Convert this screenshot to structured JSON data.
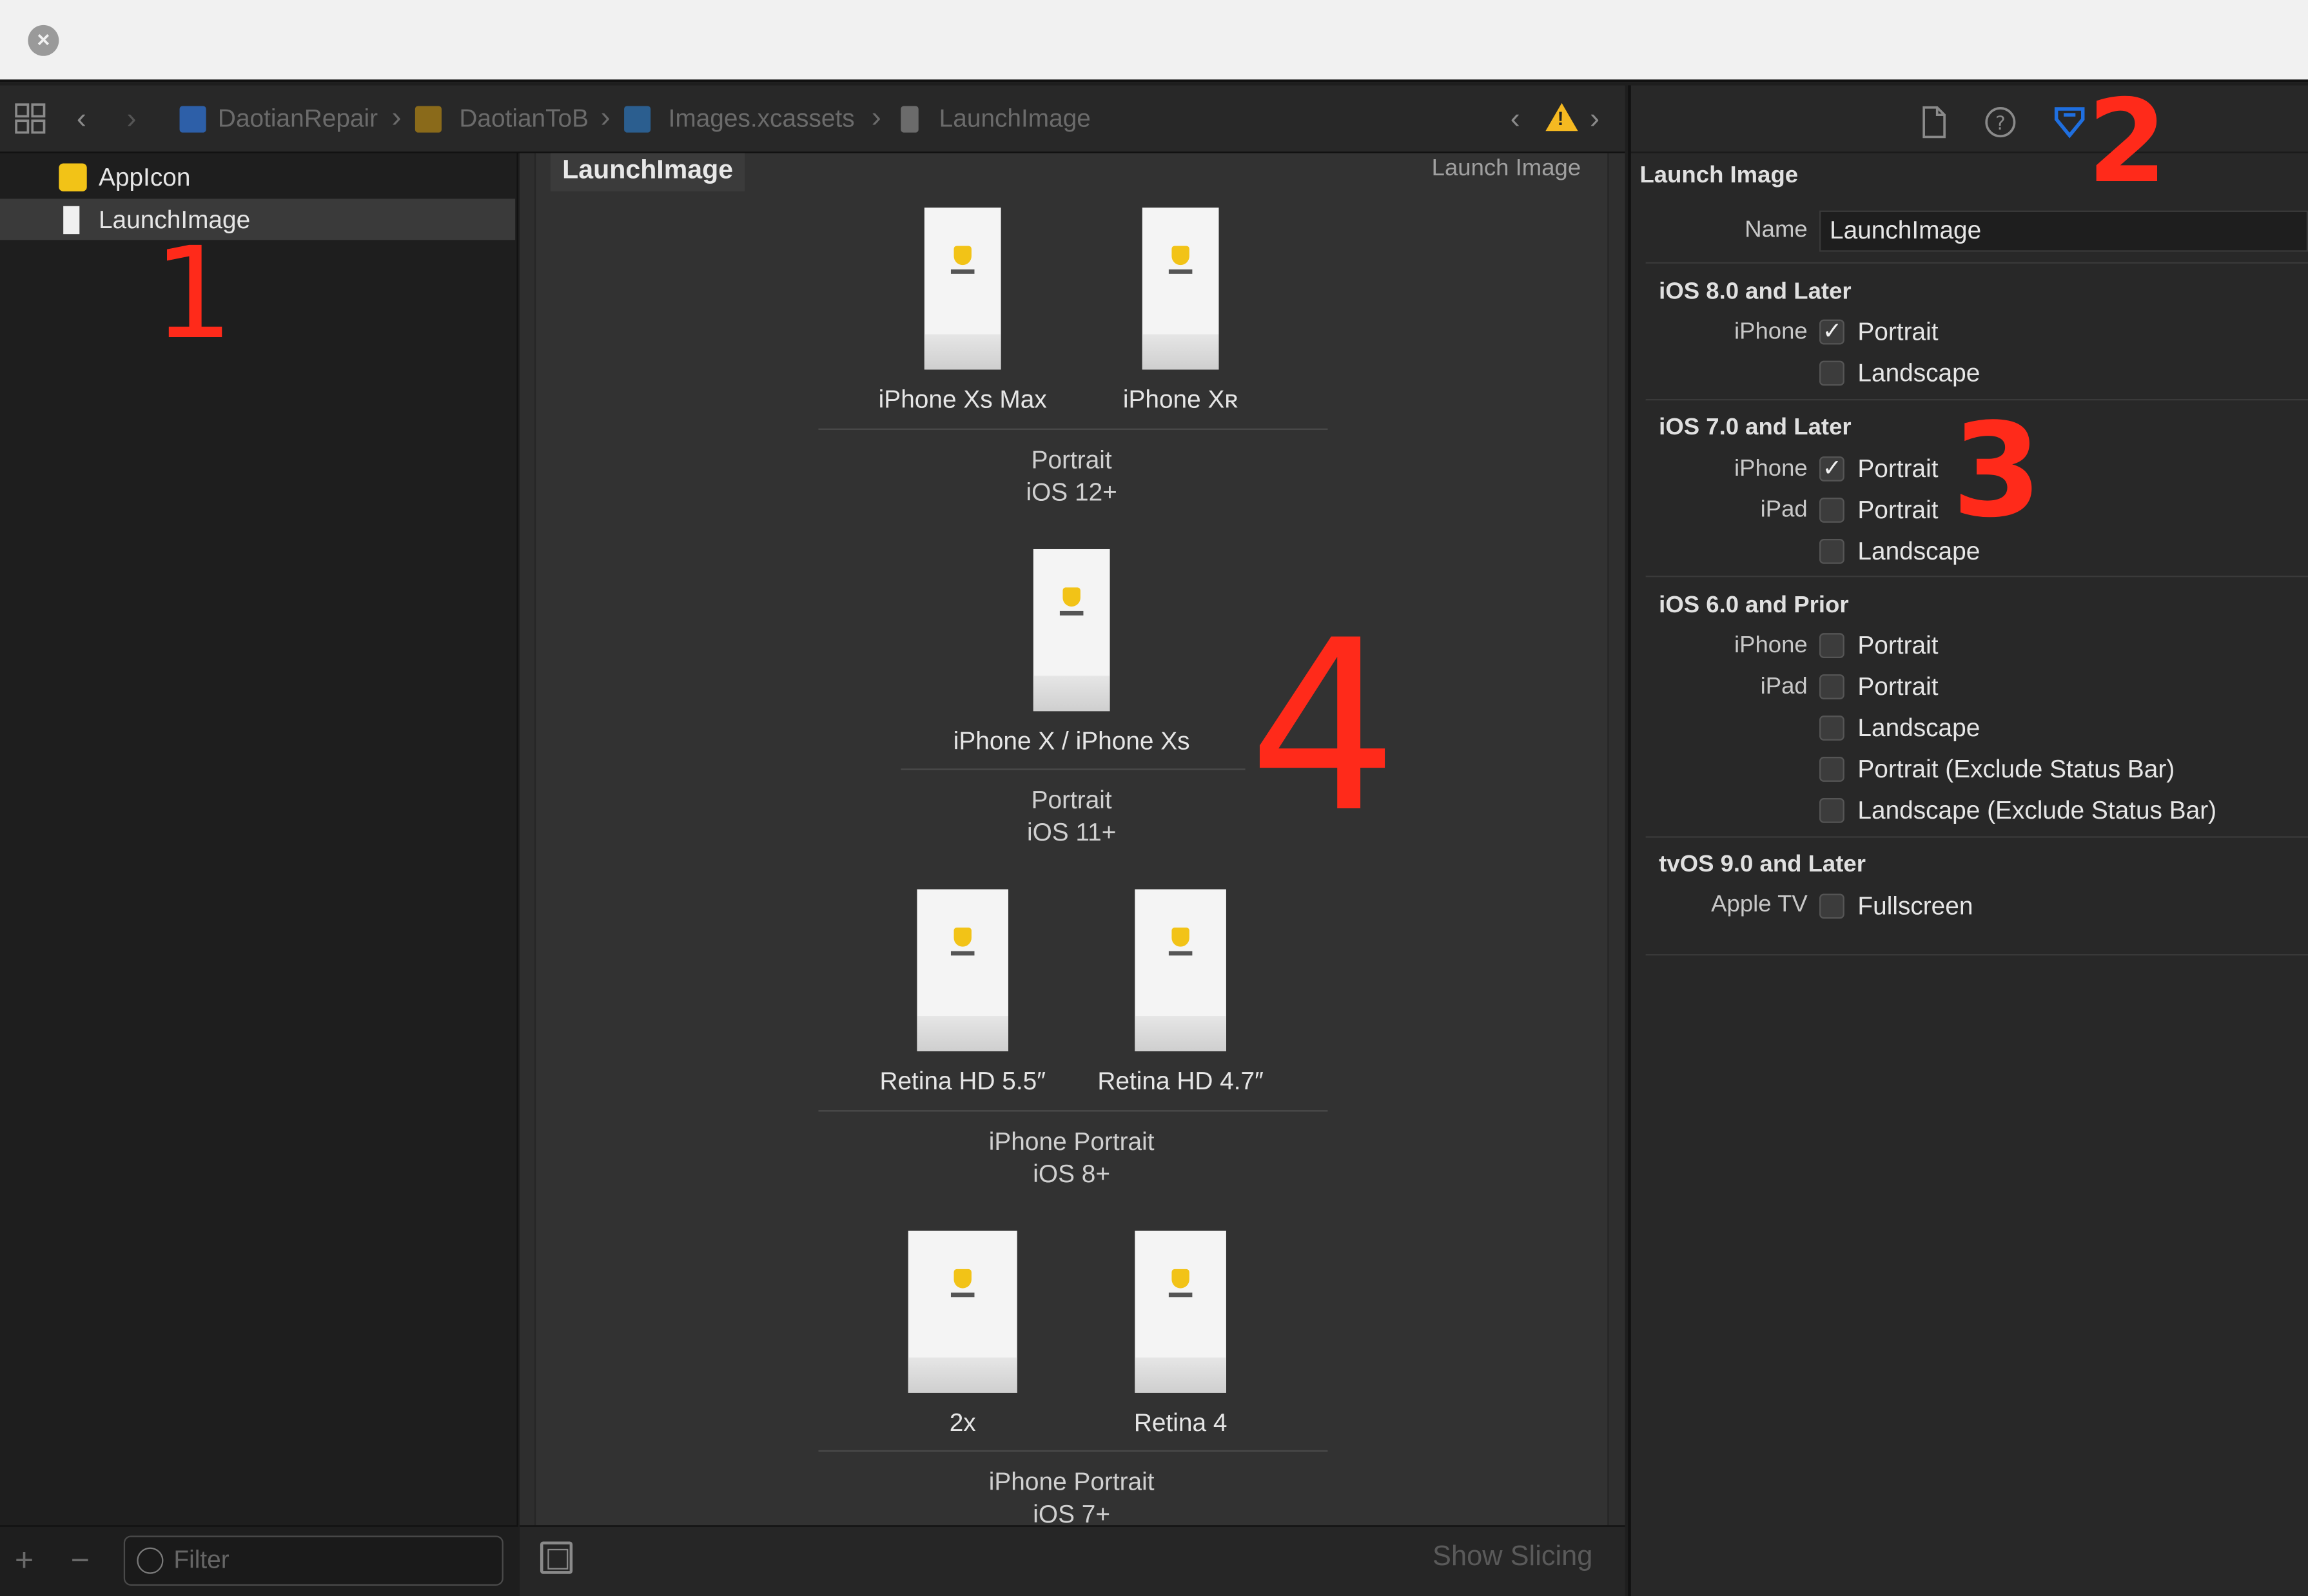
{
  "jumpbar": {
    "crumbs": [
      "DaotianRepair",
      "DaotianToB",
      "Images.xcassets",
      "LaunchImage"
    ]
  },
  "navigator": {
    "items": [
      {
        "label": "AppIcon",
        "selected": false
      },
      {
        "label": "LaunchImage",
        "selected": true
      }
    ],
    "filter_placeholder": "Filter"
  },
  "editor": {
    "set_name": "LaunchImage",
    "set_type": "Launch Image",
    "groups": [
      {
        "slots": [
          "iPhone Xs Max",
          "iPhone Xʀ"
        ],
        "line1": "Portrait",
        "line2": "iOS 12+"
      },
      {
        "slots": [
          "iPhone X / iPhone Xs"
        ],
        "line1": "Portrait",
        "line2": "iOS 11+"
      },
      {
        "slots": [
          "Retina HD 5.5″",
          "Retina HD 4.7″"
        ],
        "line1": "iPhone Portrait",
        "line2": "iOS 8+"
      },
      {
        "slots": [
          "2x",
          "Retina 4"
        ],
        "line1": "iPhone Portrait",
        "line2": "iOS 7+"
      }
    ],
    "show_slicing": "Show Slicing"
  },
  "inspector": {
    "title": "Launch Image",
    "name_label": "Name",
    "name_value": "LaunchImage",
    "sections": [
      {
        "title": "iOS 8.0 and Later",
        "rows": [
          {
            "device": "iPhone",
            "option": "Portrait",
            "checked": true
          },
          {
            "device": "",
            "option": "Landscape",
            "checked": false
          }
        ]
      },
      {
        "title": "iOS 7.0 and Later",
        "rows": [
          {
            "device": "iPhone",
            "option": "Portrait",
            "checked": true
          },
          {
            "device": "iPad",
            "option": "Portrait",
            "checked": false
          },
          {
            "device": "",
            "option": "Landscape",
            "checked": false
          }
        ]
      },
      {
        "title": "iOS 6.0 and Prior",
        "rows": [
          {
            "device": "iPhone",
            "option": "Portrait",
            "checked": false
          },
          {
            "device": "iPad",
            "option": "Portrait",
            "checked": false
          },
          {
            "device": "",
            "option": "Landscape",
            "checked": false
          },
          {
            "device": "",
            "option": "Portrait (Exclude Status Bar)",
            "checked": false
          },
          {
            "device": "",
            "option": "Landscape (Exclude Status Bar)",
            "checked": false
          }
        ]
      },
      {
        "title": "tvOS 9.0 and Later",
        "rows": [
          {
            "device": "Apple TV",
            "option": "Fullscreen",
            "checked": false
          }
        ]
      }
    ]
  },
  "annotations": [
    "1",
    "2",
    "3",
    "4"
  ],
  "colors": {
    "accent": "#1f6fe0",
    "warning": "#f5b921",
    "annotation": "#ff2a1a",
    "app_icon": "#f2c317"
  },
  "icons": [
    "close-icon",
    "grid-icon",
    "back-icon",
    "forward-icon",
    "file-icon",
    "help-icon",
    "attributes-icon",
    "warning-icon",
    "filter-icon",
    "add-icon",
    "remove-icon"
  ]
}
